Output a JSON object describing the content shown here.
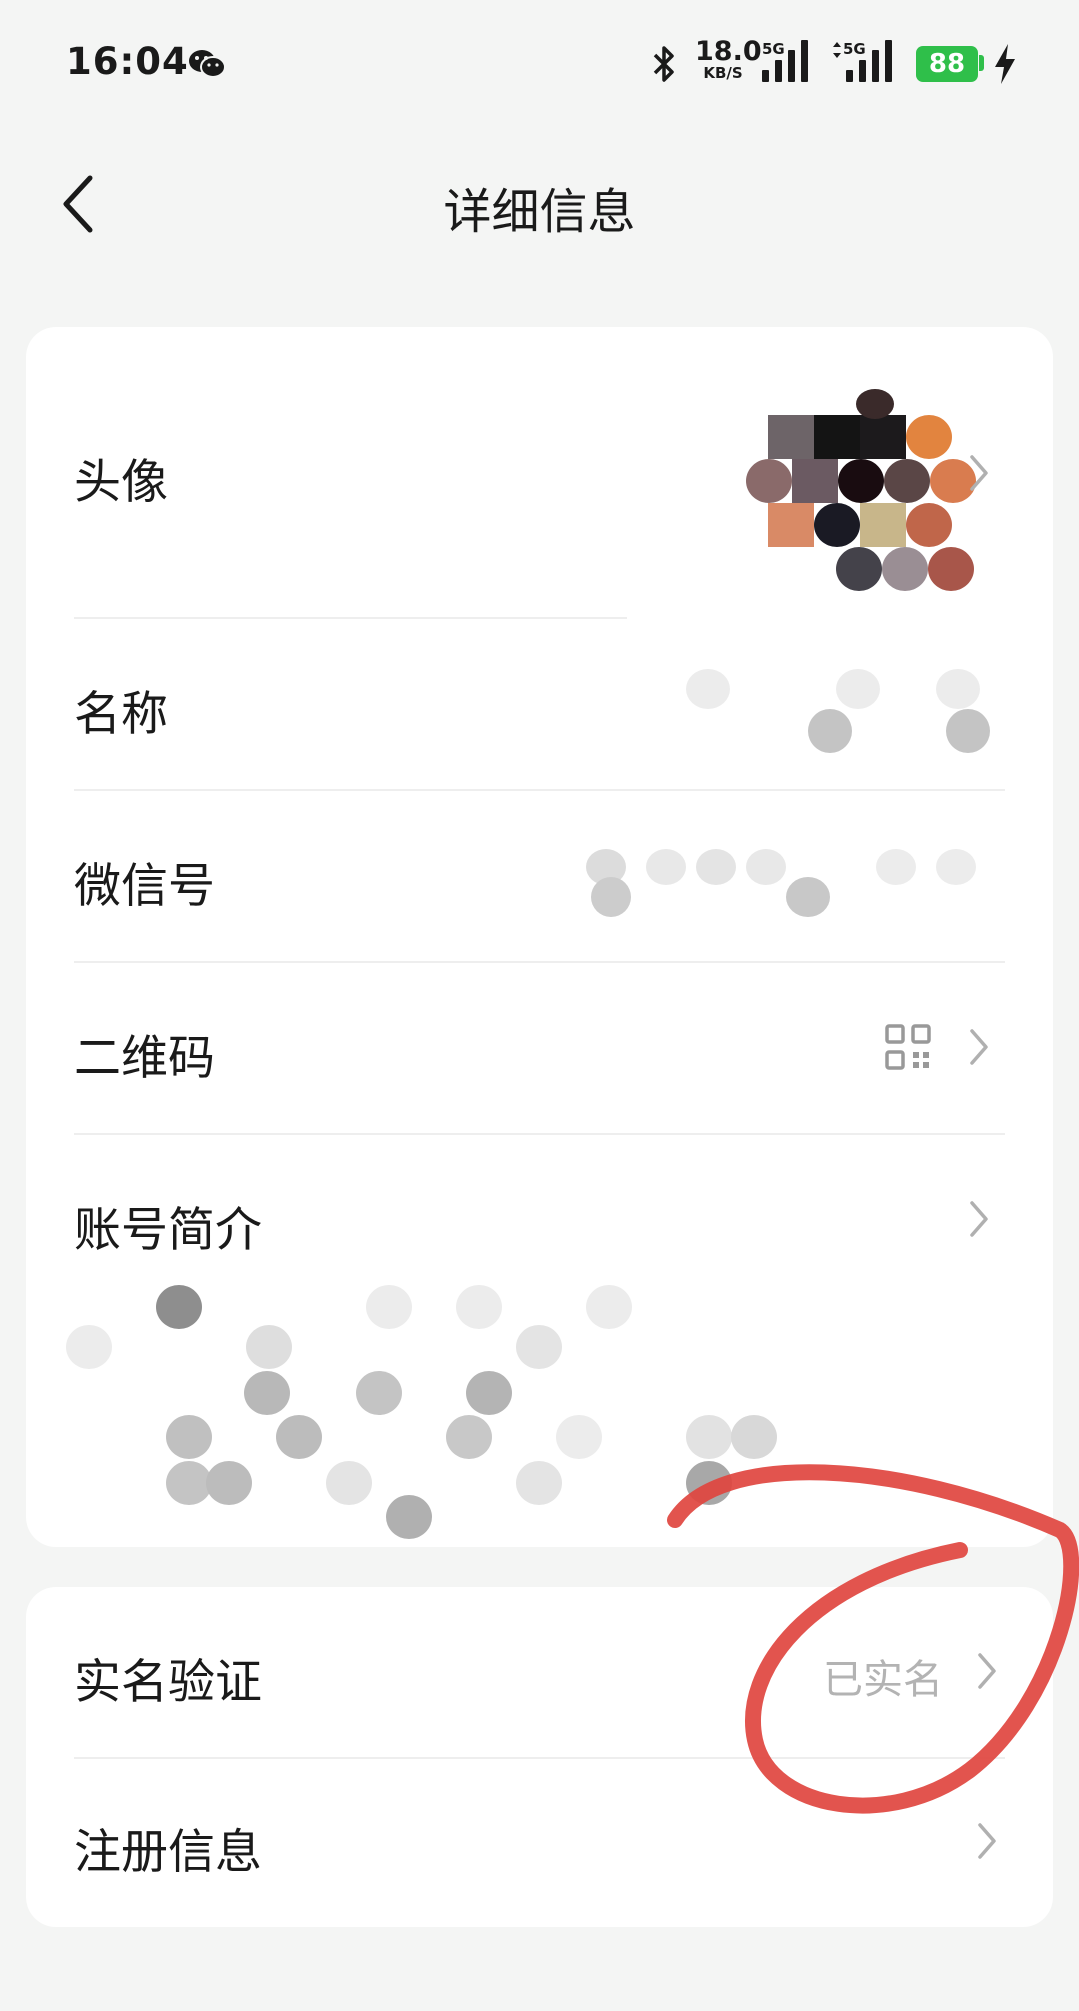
{
  "status_bar": {
    "time": "16:04",
    "net_speed_value": "18.0",
    "net_speed_unit": "KB/S",
    "signal_1_label": "5G",
    "signal_2_label": "5G",
    "battery_level": "88",
    "icons": [
      "wechat-notification-icon",
      "bluetooth-icon",
      "signal-icon",
      "battery-icon",
      "charging-icon"
    ]
  },
  "header": {
    "title": "详细信息",
    "back_icon": "chevron-left-icon"
  },
  "profile_card": {
    "rows": [
      {
        "label": "头像",
        "value_icon": "avatar"
      },
      {
        "label": "名称"
      },
      {
        "label": "微信号"
      },
      {
        "label": "二维码",
        "value_icon": "qr-code-icon"
      },
      {
        "label": "账号简介"
      }
    ]
  },
  "verify_card": {
    "rows": [
      {
        "label": "实名验证",
        "value": "已实名"
      },
      {
        "label": "注册信息"
      }
    ]
  },
  "colors": {
    "background": "#f4f5f4",
    "card": "#ffffff",
    "battery": "#2fbf4a",
    "muted_text": "#b3b3b3",
    "annotation": "#e0453f"
  }
}
